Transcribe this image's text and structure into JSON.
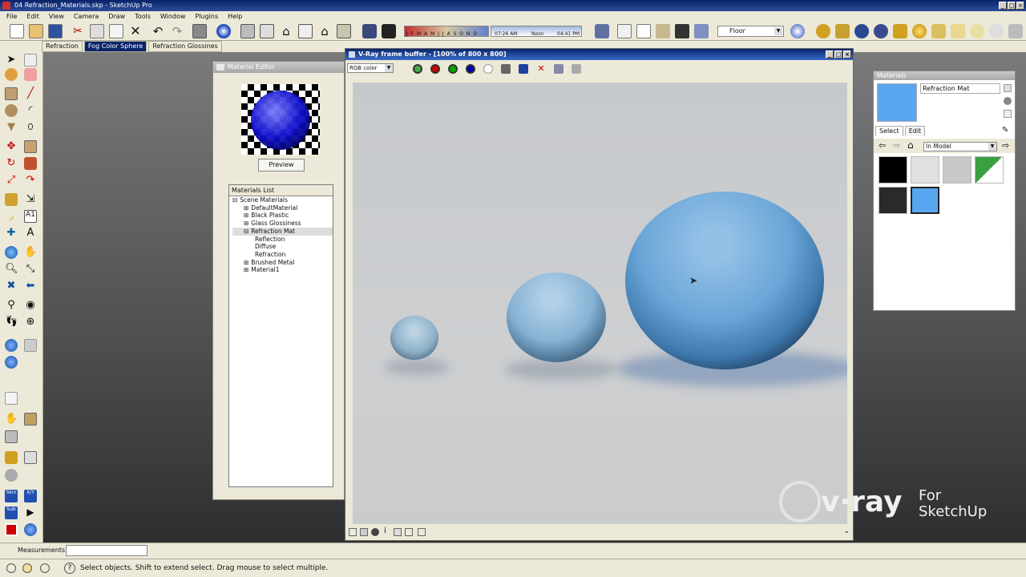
{
  "window": {
    "title": "04 Refraction_Materials.skp - SketchUp Pro"
  },
  "menu": [
    "File",
    "Edit",
    "View",
    "Camera",
    "Draw",
    "Tools",
    "Window",
    "Plugins",
    "Help"
  ],
  "toolbar": {
    "months": "J F M A M J J A S O N D",
    "time_start": "07:26 AM",
    "noon": "Noon",
    "time_end": "04:41 PM",
    "layer": "Floor"
  },
  "scene_tabs": [
    {
      "label": "Refraction",
      "active": false
    },
    {
      "label": "Fog Color Sphere",
      "active": true
    },
    {
      "label": "Refraction Glossines",
      "active": false
    }
  ],
  "material_editor": {
    "title": "Material Editor",
    "preview_button": "Preview",
    "list_title": "Materials List",
    "tree": [
      {
        "label": "Scene Materials",
        "sign": "⊟",
        "level": 0,
        "selected": false
      },
      {
        "label": "DefaultMaterial",
        "sign": "⊞",
        "level": 1,
        "selected": false
      },
      {
        "label": "Black Plastic",
        "sign": "⊞",
        "level": 1,
        "selected": false
      },
      {
        "label": "Glass Glossiness",
        "sign": "⊞",
        "level": 1,
        "selected": false
      },
      {
        "label": "Refraction Mat",
        "sign": "⊟",
        "level": 1,
        "selected": true
      },
      {
        "label": "Reflection",
        "sign": "",
        "level": 2,
        "selected": false
      },
      {
        "label": "Diffuse",
        "sign": "",
        "level": 2,
        "selected": false
      },
      {
        "label": "Refraction",
        "sign": "",
        "level": 2,
        "selected": false
      },
      {
        "label": "Brushed Metal",
        "sign": "⊞",
        "level": 1,
        "selected": false
      },
      {
        "label": "Material1",
        "sign": "⊞",
        "level": 1,
        "selected": false
      }
    ]
  },
  "vfb": {
    "title": "V-Ray frame buffer - [100% of 800 x 800]",
    "channel": "RGB color"
  },
  "materials_panel": {
    "title": "Materials",
    "current_name": "Refraction Mat",
    "tabs": [
      "Select",
      "Edit"
    ],
    "library": "In Model",
    "swatch_colors": [
      "#000000",
      "#e0e0e0",
      "#c8c8c8",
      "#3aa040",
      "#2a2a2a",
      "#59a6f0"
    ]
  },
  "measurements": {
    "label": "Measurements",
    "value": ""
  },
  "status": {
    "hint": "Select objects. Shift to extend select. Drag mouse to select multiple."
  },
  "logo": {
    "brand": "v·ray",
    "for": "For",
    "product": "SketchUp"
  },
  "colors": {
    "accent": "#0a246a",
    "material_blue": "#59a6f0"
  }
}
